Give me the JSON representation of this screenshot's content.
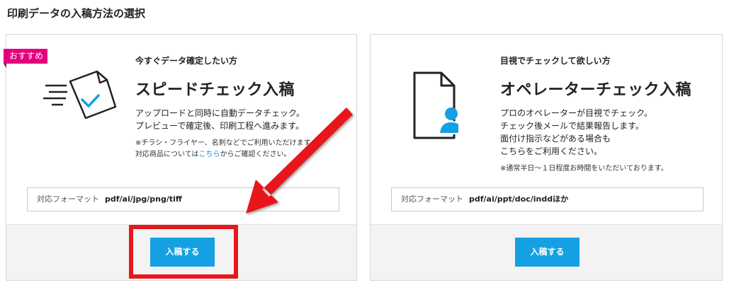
{
  "page": {
    "title": "印刷データの入稿方法の選択"
  },
  "cards": [
    {
      "badge": "おすすめ",
      "subtitle": "今すぐデータ確定したい方",
      "title": "スピードチェック入稿",
      "desc": [
        "アップロードと同時に自動データチェック。",
        "プレビューで確定後、印刷工程へ進みます。"
      ],
      "note_line1": "※チラシ・フライヤー、名刺などでご利用いただけます。",
      "note_line2_pre": "対応商品については",
      "note_line2_link": "こちら",
      "note_line2_post": "からご確認ください。",
      "format_label": "対応フォーマット",
      "format_value": "pdf/ai/jpg/png/tiff",
      "button_label": "入稿する",
      "icon": "document-check-speed-icon"
    },
    {
      "subtitle": "目視でチェックして欲しい方",
      "title": "オペレーターチェック入稿",
      "desc": [
        "プロのオペレーターが目視でチェック。",
        "チェック後メールで結果報告します。",
        "面付け指示などがある場合も",
        "こちらをご利用ください。"
      ],
      "note": "※通常半日～１日程度お時間をいただいております。",
      "format_label": "対応フォーマット",
      "format_value": "pdf/ai/ppt/doc/inddほか",
      "button_label": "入稿する",
      "icon": "document-person-icon"
    }
  ],
  "colors": {
    "accent": "#15a0e4",
    "badge": "#e4007f",
    "highlight": "#e8171c",
    "link": "#1a8fd6"
  }
}
